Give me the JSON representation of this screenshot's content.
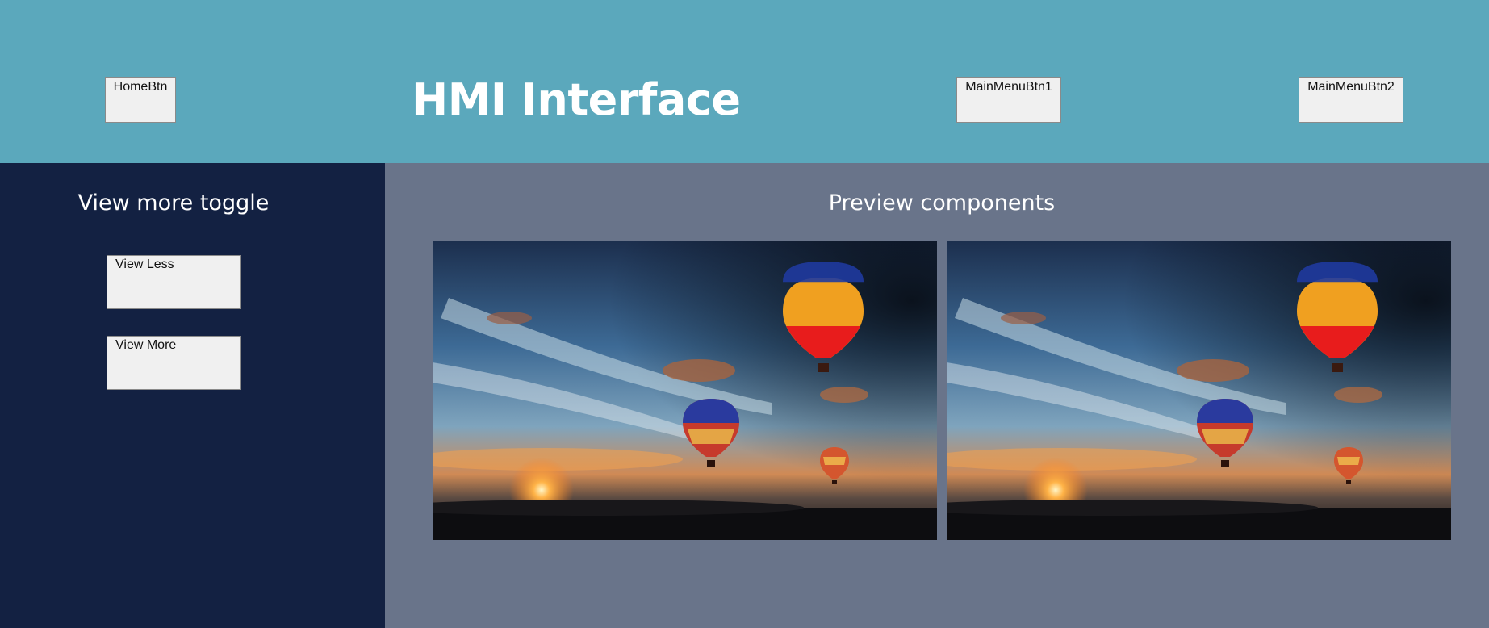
{
  "header": {
    "title": "HMI Interface",
    "home_button": "HomeBtn",
    "menu_button_1": "MainMenuBtn1",
    "menu_button_2": "MainMenuBtn2"
  },
  "sidebar": {
    "title": "View more toggle",
    "view_less_button": "View Less",
    "view_more_button": "View More"
  },
  "main": {
    "title": "Preview components",
    "previews": [
      {
        "subject": "hot-air-balloons-at-sunset"
      },
      {
        "subject": "hot-air-balloons-at-sunset"
      }
    ]
  },
  "colors": {
    "header_bg": "#5ba8bc",
    "sidebar_bg": "#132142",
    "main_bg": "#69748a",
    "button_bg": "#f0f0f0"
  }
}
